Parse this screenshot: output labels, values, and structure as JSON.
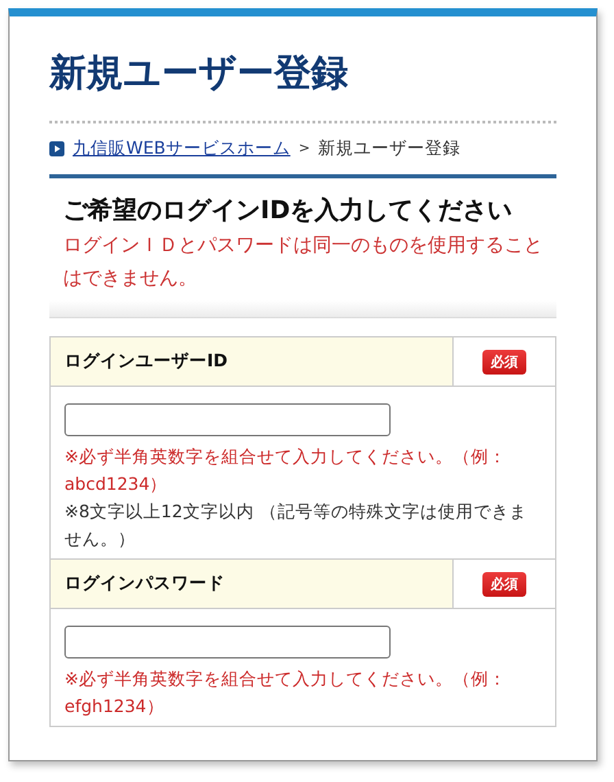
{
  "page_title": "新規ユーザー登録",
  "breadcrumb": [
    {
      "label": "九信販WEBサービスホーム",
      "kind": "link"
    },
    {
      "label": "新規ユーザー登録",
      "kind": "current"
    }
  ],
  "breadcrumb_separator": ">",
  "section": {
    "heading": "ご希望のログインIDを入力してください",
    "warning": "ログインＩＤとパスワードは同一のものを使用することはできません。"
  },
  "fields": [
    {
      "label": "ログインユーザーID",
      "badge": "必須",
      "notes": [
        {
          "text": "※必ず半角英数字を組合せて入力してください。（例：abcd1234）",
          "kind": "alert"
        },
        {
          "text": "※8文字以上12文字以内 （記号等の特殊文字は使用できません。）",
          "kind": "normal"
        }
      ]
    },
    {
      "label": "ログインパスワード",
      "badge": "必須",
      "notes": [
        {
          "text": "※必ず半角英数字を組合せて入力してください。（例：efgh1234）",
          "kind": "alert"
        }
      ]
    }
  ]
}
